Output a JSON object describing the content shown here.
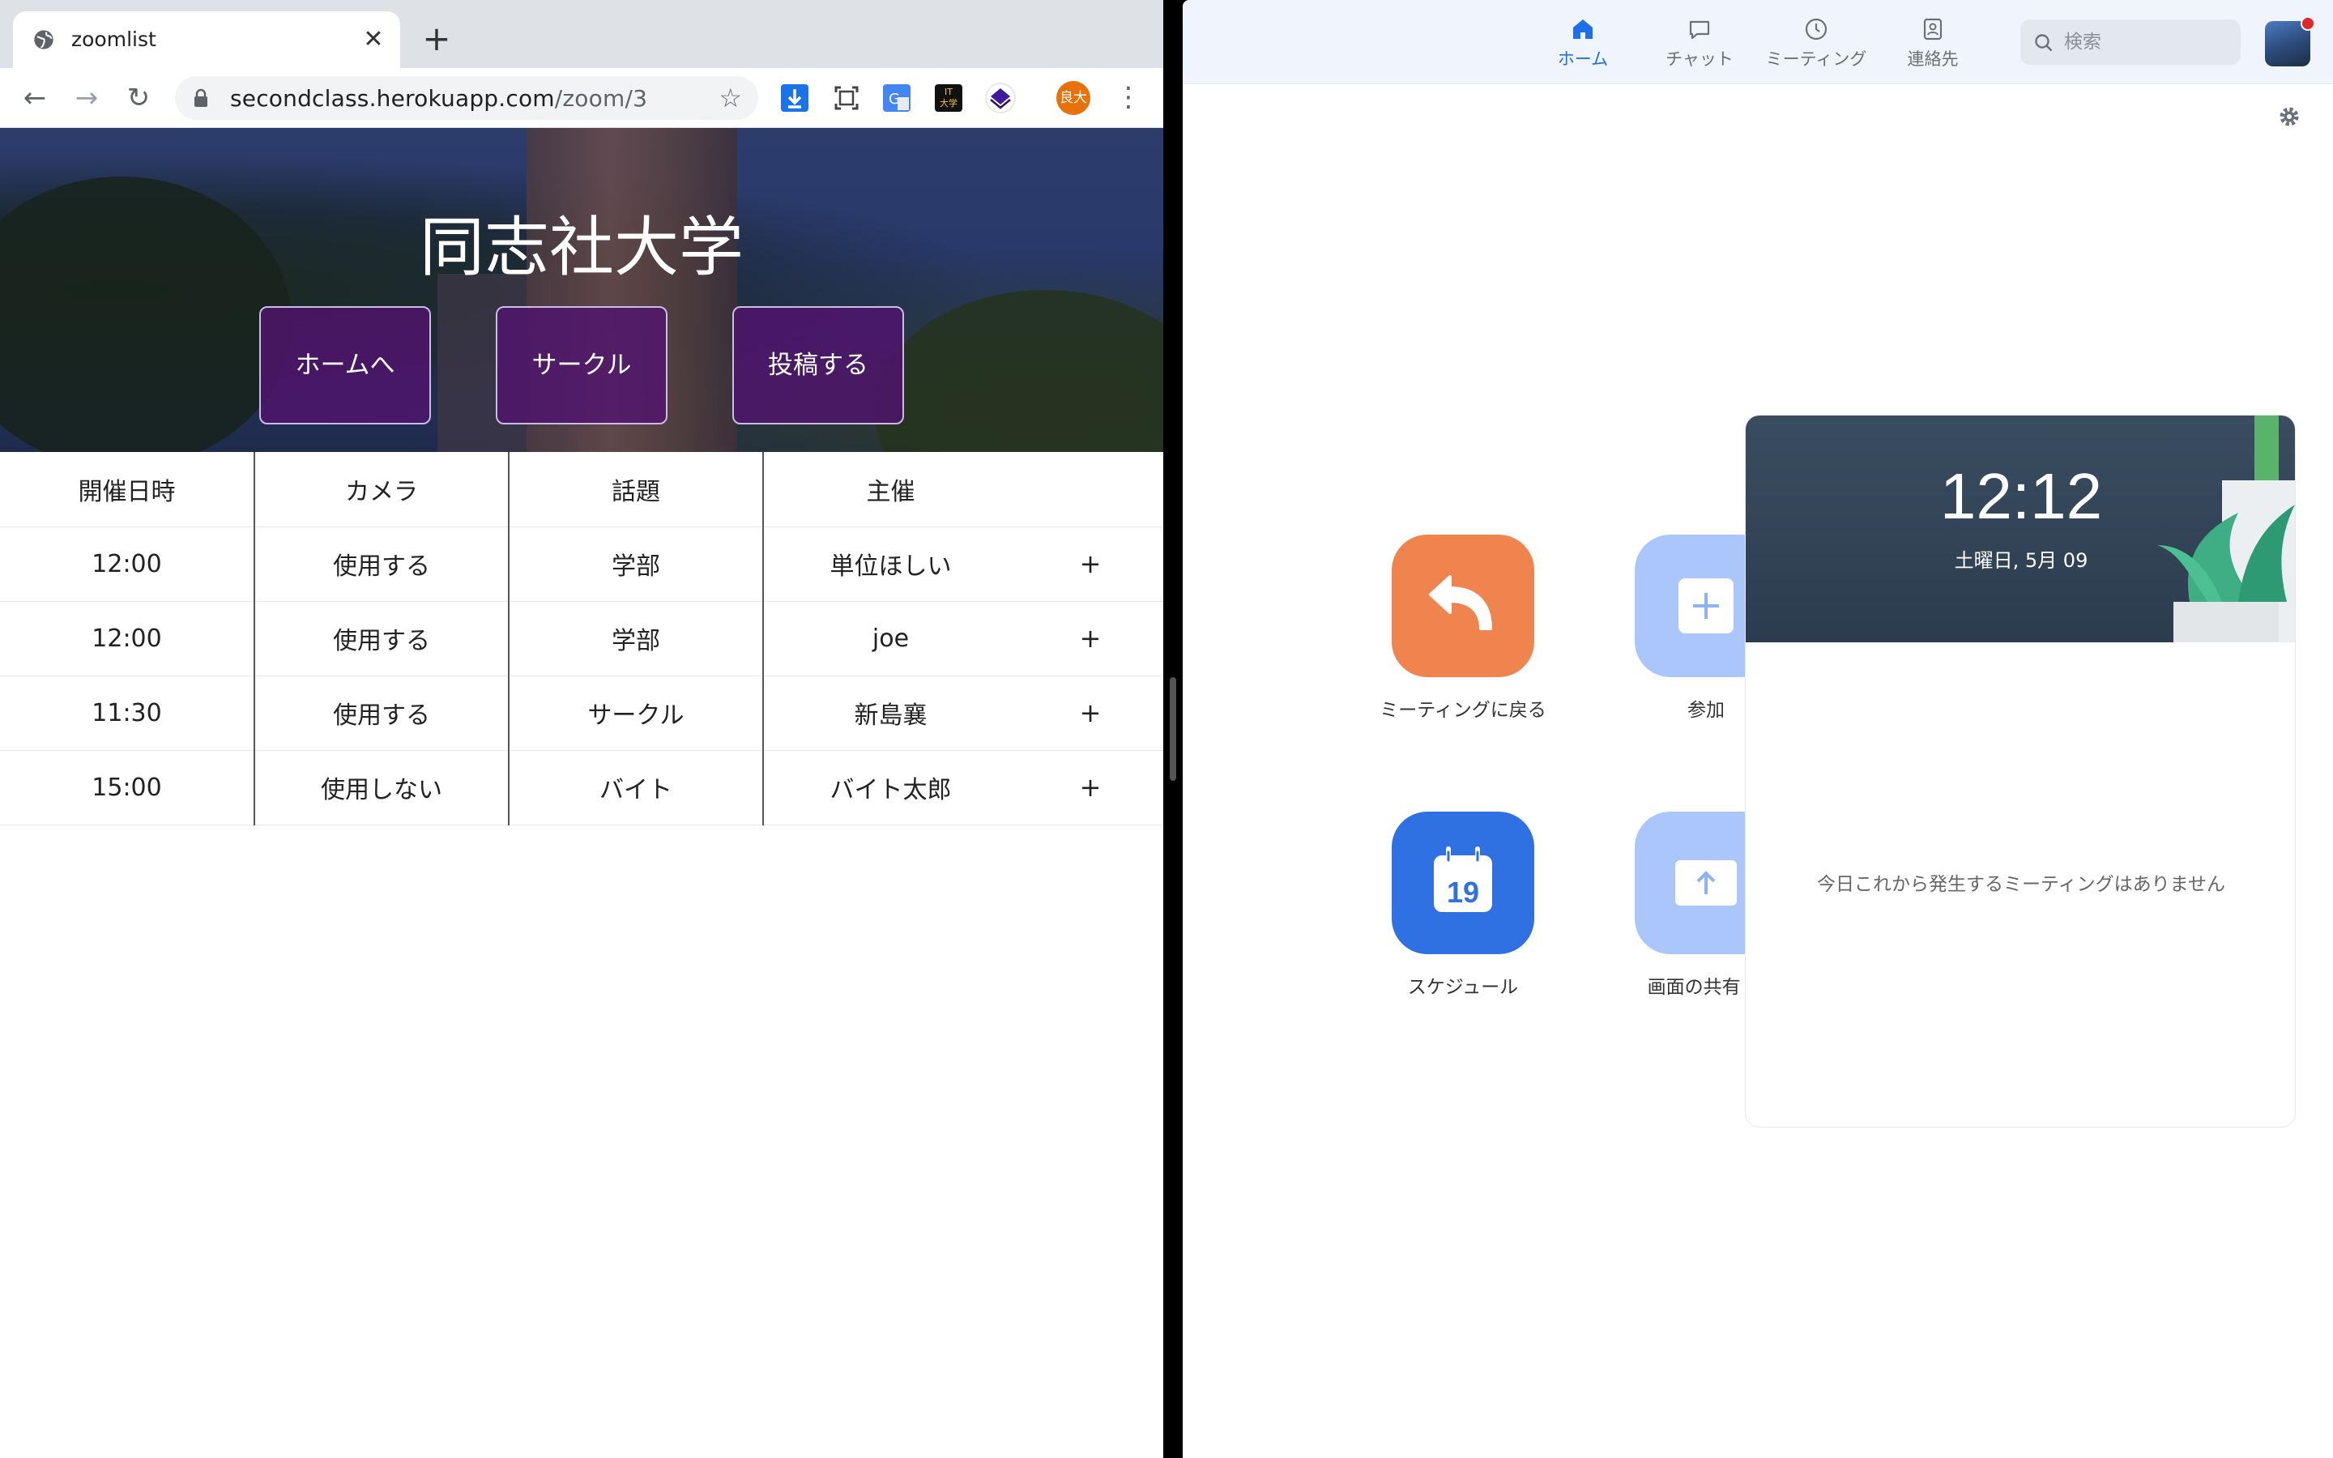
{
  "browser": {
    "tab_title": "zoomlist",
    "new_tab_label": "+",
    "url_domain": "secondclass.herokuapp.com",
    "url_path": "/zoom/3",
    "profile_initials": "良大",
    "ext_label_it": "IT\n大学"
  },
  "page": {
    "hero_title": "同志社大学",
    "buttons": [
      "ホームへ",
      "サークル",
      "投稿する"
    ],
    "table_headers": [
      "開催日時",
      "カメラ",
      "話題",
      "主催",
      ""
    ],
    "rows": [
      [
        "12:00",
        "使用する",
        "学部",
        "単位ほしい",
        "+"
      ],
      [
        "12:00",
        "使用する",
        "学部",
        "joe",
        "+"
      ],
      [
        "11:30",
        "使用する",
        "サークル",
        "新島襄",
        "+"
      ],
      [
        "15:00",
        "使用しない",
        "バイト",
        "バイト太郎",
        "+"
      ]
    ]
  },
  "zoom": {
    "nav": [
      {
        "label": "ホーム",
        "icon": "home-icon",
        "active": true
      },
      {
        "label": "チャット",
        "icon": "chat-icon",
        "active": false
      },
      {
        "label": "ミーティング",
        "icon": "clock-icon",
        "active": false
      },
      {
        "label": "連絡先",
        "icon": "contacts-icon",
        "active": false
      }
    ],
    "search_placeholder": "検索",
    "actions": [
      {
        "label": "ミーティングに戻る",
        "icon": "return-arrow-icon"
      },
      {
        "label": "参加",
        "icon": "plus-icon"
      },
      {
        "label": "スケジュール",
        "icon": "calendar-icon",
        "calendar_day": "19"
      },
      {
        "label": "画面の共有",
        "icon": "share-up-arrow-icon",
        "has_dropdown": true
      }
    ],
    "clock_time": "12:12",
    "clock_date": "土曜日, 5月 09",
    "no_meetings_text": "今日これから発生するミーティングはありません",
    "colors": {
      "accent_blue": "#2f71e3",
      "return_orange": "#f0844e",
      "light_blue": "#aac6fa",
      "hero_button_purple": "#50146e"
    }
  }
}
